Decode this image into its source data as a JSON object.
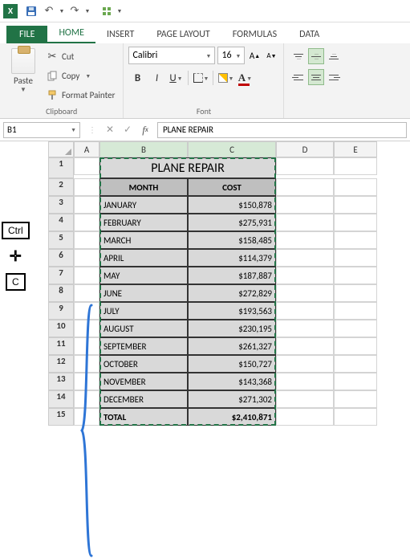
{
  "qat": {
    "save_title": "Save",
    "undo_title": "Undo",
    "redo_title": "Redo",
    "customize_title": "Customize"
  },
  "tabs": {
    "file": "FILE",
    "home": "HOME",
    "insert": "INSERT",
    "page_layout": "PAGE LAYOUT",
    "formulas": "FORMULAS",
    "data": "DATA"
  },
  "clipboard": {
    "paste": "Paste",
    "cut": "Cut",
    "copy": "Copy",
    "format_painter": "Format Painter",
    "group_label": "Clipboard"
  },
  "font": {
    "name": "Calibri",
    "size": "16",
    "group_label": "Font"
  },
  "formula_bar": {
    "name_box": "B1",
    "value": "PLANE REPAIR"
  },
  "columns": [
    "A",
    "B",
    "C",
    "D",
    "E"
  ],
  "rows": [
    "1",
    "2",
    "3",
    "4",
    "5",
    "6",
    "7",
    "8",
    "9",
    "10",
    "11",
    "12",
    "13",
    "14",
    "15"
  ],
  "sheet": {
    "title": "PLANE REPAIR",
    "headers": {
      "month": "MONTH",
      "cost": "COST"
    },
    "data": [
      {
        "month": "JANUARY",
        "cost": "$150,878"
      },
      {
        "month": "FEBRUARY",
        "cost": "$275,931"
      },
      {
        "month": "MARCH",
        "cost": "$158,485"
      },
      {
        "month": "APRIL",
        "cost": "$114,379"
      },
      {
        "month": "MAY",
        "cost": "$187,887"
      },
      {
        "month": "JUNE",
        "cost": "$272,829"
      },
      {
        "month": "JULY",
        "cost": "$193,563"
      },
      {
        "month": "AUGUST",
        "cost": "$230,195"
      },
      {
        "month": "SEPTEMBER",
        "cost": "$261,327"
      },
      {
        "month": "OCTOBER",
        "cost": "$150,727"
      },
      {
        "month": "NOVEMBER",
        "cost": "$143,368"
      },
      {
        "month": "DECEMBER",
        "cost": "$271,302"
      }
    ],
    "total": {
      "label": "TOTAL",
      "cost": "$2,410,871"
    }
  },
  "keys": {
    "ctrl": "Ctrl",
    "c": "C"
  },
  "chart_data": {
    "type": "table",
    "title": "PLANE REPAIR",
    "columns": [
      "MONTH",
      "COST"
    ],
    "rows": [
      [
        "JANUARY",
        150878
      ],
      [
        "FEBRUARY",
        275931
      ],
      [
        "MARCH",
        158485
      ],
      [
        "APRIL",
        114379
      ],
      [
        "MAY",
        187887
      ],
      [
        "JUNE",
        272829
      ],
      [
        "JULY",
        193563
      ],
      [
        "AUGUST",
        230195
      ],
      [
        "SEPTEMBER",
        261327
      ],
      [
        "OCTOBER",
        150727
      ],
      [
        "NOVEMBER",
        143368
      ],
      [
        "DECEMBER",
        271302
      ]
    ],
    "total": 2410871
  }
}
